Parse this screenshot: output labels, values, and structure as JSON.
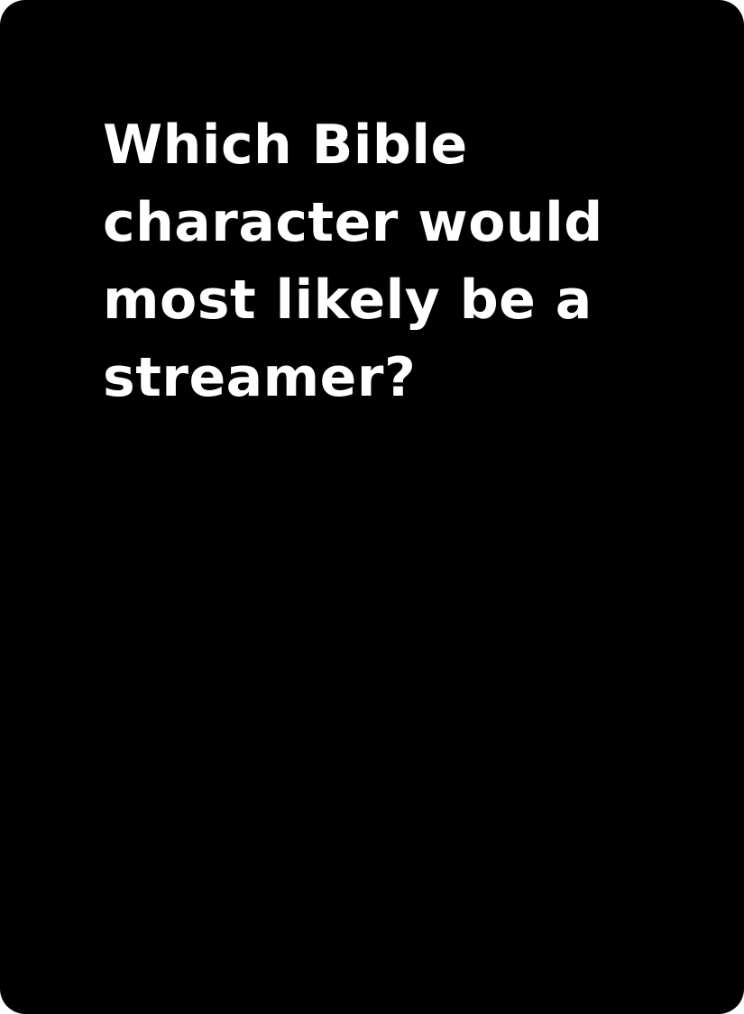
{
  "card": {
    "background": "#000000",
    "text_color": "#ffffff",
    "prompt_lines": [
      "Which Bible",
      "character would",
      "most likely be a",
      "streamer?"
    ]
  }
}
